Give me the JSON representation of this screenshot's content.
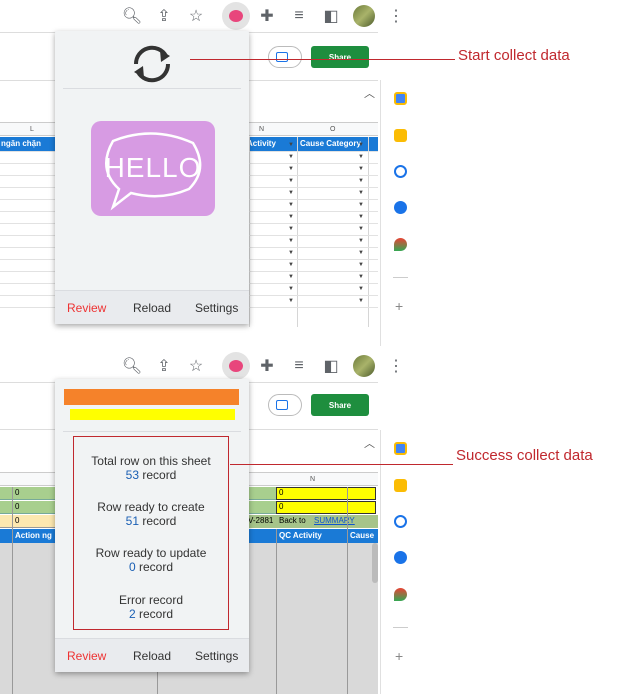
{
  "annotations": {
    "start": "Start collect data",
    "success": "Success collect data"
  },
  "top": {
    "share_label": "Share",
    "columns": [
      "L",
      "N",
      "O"
    ],
    "headers": [
      "ngăn chặn",
      "Activity",
      "Cause Category"
    ],
    "popup": {
      "footer": {
        "review": "Review",
        "reload": "Reload",
        "settings": "Settings"
      },
      "hello_text": "HELLO"
    }
  },
  "bottom": {
    "share_label": "Share",
    "column_n": "N",
    "cells": {
      "row3_a": "0",
      "row3_b": "0",
      "row4_a": "0",
      "row4_b": "0",
      "row5_a": "0",
      "row5_id": "V-2881",
      "row5_back": "Back to",
      "row5_link": "SUMMARY"
    },
    "headers": [
      "Action ng",
      "QC Activity",
      "Cause"
    ],
    "popup": {
      "stats": [
        {
          "label": "Total row on this sheet",
          "count": "53",
          "unit": "record"
        },
        {
          "label": "Row ready to create",
          "count": "51",
          "unit": "record"
        },
        {
          "label": "Row ready to update",
          "count": "0",
          "unit": "record"
        },
        {
          "label": "Error record",
          "count": "2",
          "unit": "record"
        }
      ],
      "footer": {
        "review": "Review",
        "reload": "Reload",
        "settings": "Settings"
      }
    }
  },
  "colors": {
    "annotation": "#c0282e",
    "share": "#1e8e3e",
    "header_blue": "#1a7ad6",
    "review": "#e33333"
  }
}
